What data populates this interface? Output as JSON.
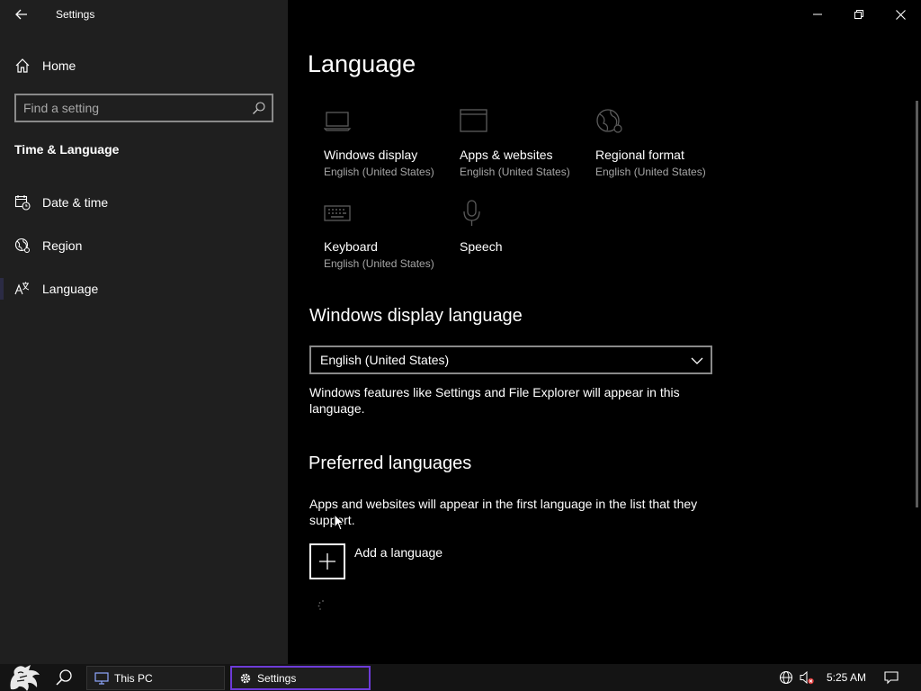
{
  "window": {
    "app_title": "Settings",
    "controls": [
      "minimize",
      "restore",
      "close"
    ]
  },
  "sidebar": {
    "home_label": "Home",
    "search_placeholder": "Find a setting",
    "section_header": "Time & Language",
    "items": [
      {
        "label": "Date & time",
        "icon": "calendar-clock-icon"
      },
      {
        "label": "Region",
        "icon": "globe-region-icon"
      },
      {
        "label": "Language",
        "icon": "language-icon",
        "selected": true
      }
    ]
  },
  "main": {
    "title": "Language",
    "tiles": [
      {
        "name": "Windows display",
        "sub": "English (United States)",
        "icon": "monitor-icon"
      },
      {
        "name": "Apps & websites",
        "sub": "English (United States)",
        "icon": "browser-window-icon"
      },
      {
        "name": "Regional format",
        "sub": "English (United States)",
        "icon": "regional-globe-icon"
      },
      {
        "name": "Keyboard",
        "sub": "English (United States)",
        "icon": "keyboard-icon"
      },
      {
        "name": "Speech",
        "sub": "",
        "icon": "microphone-icon"
      }
    ],
    "display_language": {
      "heading": "Windows display language",
      "selected": "English (United States)",
      "description": "Windows features like Settings and File Explorer will appear in this language."
    },
    "preferred": {
      "heading": "Preferred languages",
      "description": "Apps and websites will appear in the first language in the list that they support.",
      "add_label": "Add a language"
    }
  },
  "taskbar": {
    "this_pc_label": "This PC",
    "settings_label": "Settings",
    "time": "5:25 AM",
    "accent_color": "#6d3bd8"
  }
}
